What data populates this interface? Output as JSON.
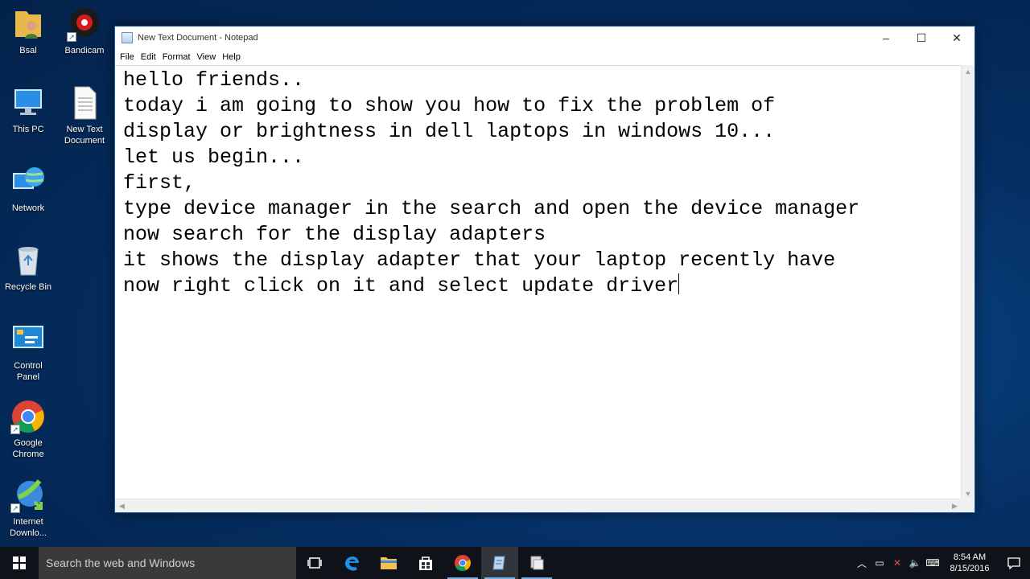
{
  "desktop": {
    "icons": [
      {
        "label": "Bsal"
      },
      {
        "label": "Bandicam"
      },
      {
        "label": "This PC"
      },
      {
        "label": "New Text\nDocument"
      },
      {
        "label": "Network"
      },
      {
        "label": "Recycle Bin"
      },
      {
        "label": "Control\nPanel"
      },
      {
        "label": "Google\nChrome"
      },
      {
        "label": "Internet\nDownlo..."
      }
    ]
  },
  "window": {
    "title": "New Text Document - Notepad",
    "menu": [
      "File",
      "Edit",
      "Format",
      "View",
      "Help"
    ],
    "controls": {
      "minimize": "–",
      "maximize": "☐",
      "close": "✕"
    },
    "content_lines": [
      "hello friends..",
      "",
      "today i am going to show you how to fix the problem of",
      "display or brightness in dell laptops in windows 10...",
      "",
      "let us begin...",
      "",
      "first,",
      "type device manager in the search and open the device manager",
      "now search for the display adapters",
      "it shows the display adapter that your laptop recently have",
      "now right click on it and select update driver"
    ]
  },
  "taskbar": {
    "search_placeholder": "Search the web and Windows",
    "time": "8:54 AM",
    "date": "8/15/2016"
  },
  "colors": {
    "desktop_bg": "#052f63",
    "taskbar_bg": "#101014",
    "window_border": "#1e5da8"
  }
}
